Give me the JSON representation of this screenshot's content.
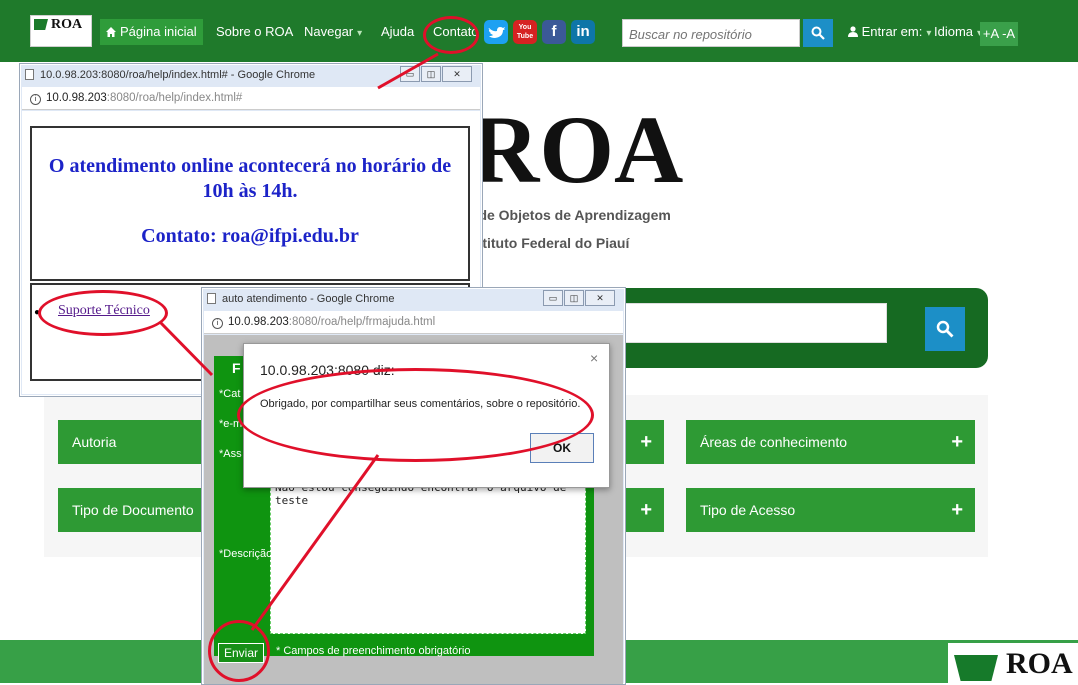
{
  "topnav": {
    "logo_text": "ROA",
    "home": "Página inicial",
    "about": "Sobre o ROA",
    "browse": "Navegar",
    "help": "Ajuda",
    "contact": "Contato",
    "search_placeholder": "Buscar no repositório",
    "login": "Entrar em:",
    "language": "Idioma",
    "accessibility": "+A -A",
    "social": [
      {
        "name": "twitter",
        "glyph": "🐦",
        "color": "#1da1f2"
      },
      {
        "name": "youtube",
        "glyph": "You Tube",
        "color": "#d62222"
      },
      {
        "name": "facebook",
        "glyph": "f",
        "color": "#3b5998"
      },
      {
        "name": "linkedin",
        "glyph": "in",
        "color": "#0e76a8"
      }
    ]
  },
  "background": {
    "big_title": "ROA",
    "tagline_1": "o de Objetos de Aprendizagem",
    "tagline_2": "nstituto Federal do Piauí",
    "cards": [
      "Autoria",
      "Tipo de Documento",
      "Áreas de conhecimento",
      "Tipo de Acesso"
    ],
    "footer_logo": "ROA"
  },
  "popup1": {
    "title": "10.0.98.203:8080/roa/help/index.html# - Google Chrome",
    "url_host": "10.0.98.203",
    "url_rest": ":8080/roa/help/index.html#",
    "line1": "O atendimento online acontecerá no horário de",
    "line2": "10h às 14h.",
    "contact_line": "Contato: roa@ifpi.edu.br",
    "link_label": "Suporte Técnico"
  },
  "popup2": {
    "title": "auto atendimento - Google Chrome",
    "url_host": "10.0.98.203",
    "url_rest": ":8080/roa/help/frmajuda.html",
    "header_letter": "F",
    "label_cat": "*Cat",
    "label_email": "*e-m",
    "label_ass": "*Ass",
    "label_desc": "*Descrição",
    "desc_value": "Não estou conseguindo encontrar o arquivo de teste",
    "submit": "Enviar",
    "required_note": "* Campos de preenchimento obrigatório"
  },
  "alert": {
    "origin": "10.0.98.203:8080 diz:",
    "message": "Obrigado, por compartilhar seus comentários, sobre o repositório.",
    "ok": "OK",
    "close": "×"
  },
  "colors": {
    "nav_green": "#1f7a2b",
    "card_green": "#2e9a34",
    "search_blue": "#1c8fc7",
    "annotation_red": "#e0102a",
    "heading_blue": "#1c23c8"
  }
}
